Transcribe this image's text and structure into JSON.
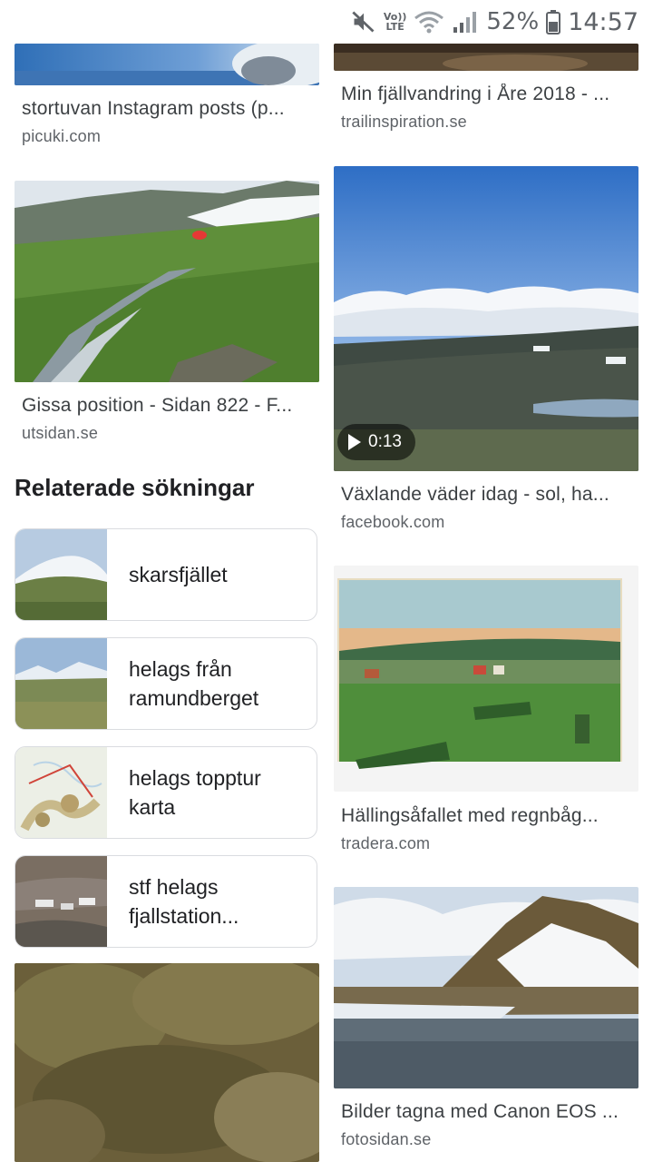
{
  "status_bar": {
    "time": "14:57",
    "battery": "52%",
    "network": "LTE",
    "volte": "Vo))",
    "icons": [
      "mute-icon",
      "volte-lte-icon",
      "wifi-icon",
      "signal-icon",
      "battery-icon"
    ]
  },
  "results_left": [
    {
      "title": "stortuvan Instagram posts (p...",
      "source": "picuki.com"
    },
    {
      "title": "Gissa position - Sidan 822 - F...",
      "source": "utsidan.se"
    }
  ],
  "results_right": [
    {
      "title": "Min fjällvandring i Åre 2018 - ...",
      "source": "trailinspiration.se"
    },
    {
      "title": "Växlande väder idag - sol, ha...",
      "source": "facebook.com",
      "video_duration": "0:13"
    },
    {
      "title": "Hällingsåfallet med regnbåg...",
      "source": "tradera.com"
    },
    {
      "title": "Bilder tagna med Canon EOS ...",
      "source": "fotosidan.se"
    }
  ],
  "related": {
    "heading": "Relaterade sökningar",
    "items": [
      {
        "line1": "skarsfjället",
        "line2": ""
      },
      {
        "line1": "helags från",
        "line2": "ramundberget"
      },
      {
        "line1": "helags topptur",
        "line2": "karta"
      },
      {
        "line1": "stf helags",
        "line2": "fjallstation..."
      }
    ]
  }
}
